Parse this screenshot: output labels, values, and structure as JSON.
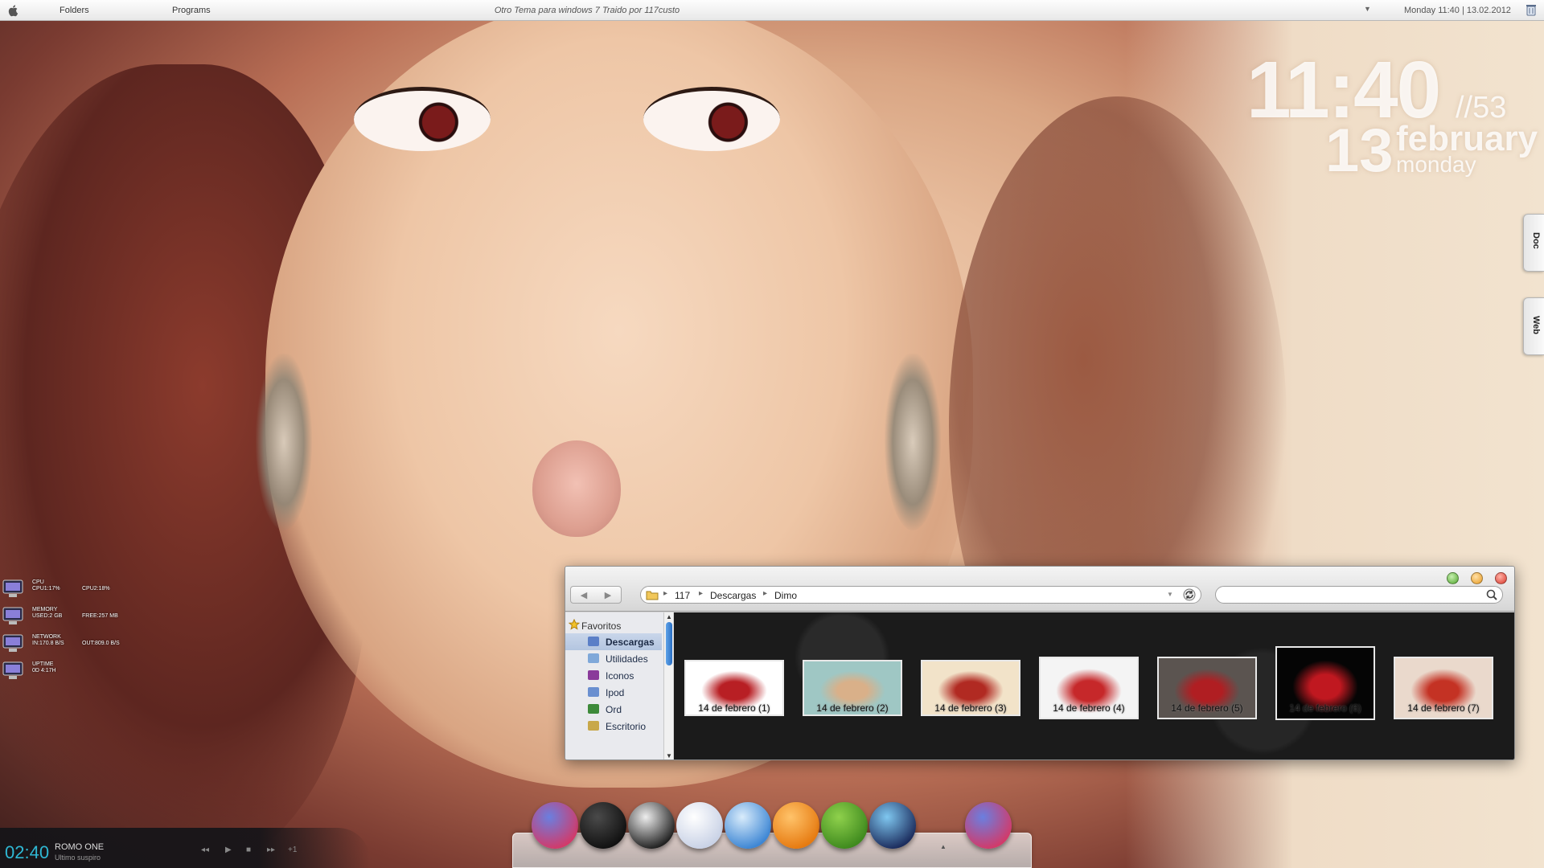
{
  "menubar": {
    "folders_label": "Folders",
    "programs_label": "Programs",
    "title": "Otro Tema para windows 7 Traido por 117custo",
    "clock": "Monday 11:40 | 13.02.2012"
  },
  "big_clock": {
    "hour_minute": "11:40",
    "seconds": "//53",
    "day": "13",
    "month": "february",
    "weekday": "monday"
  },
  "side_tabs": [
    "Doc",
    "Web"
  ],
  "sysmon": {
    "cpu": {
      "label": "CPU",
      "v1": "CPU1:17%",
      "v2": "CPU2:18%"
    },
    "memory": {
      "label": "MEMORY",
      "v1": "USED:2 GB",
      "v2": "FREE:257 MB"
    },
    "network": {
      "label": "NETWORK",
      "v1": "IN:170.8 B/S",
      "v2": "OUT:809.0 B/S"
    },
    "uptime": {
      "label": "UPTIME",
      "v1": "0D 4:17H",
      "v2": ""
    }
  },
  "explorer": {
    "breadcrumbs": [
      "117",
      "Descargas",
      "Dimo"
    ],
    "search_placeholder": "",
    "favorites_label": "Favoritos",
    "sidebar_items": [
      {
        "label": "Descargas",
        "icon": "downloads-folder-icon",
        "color": "#5b7fc7",
        "selected": true
      },
      {
        "label": "Utilidades",
        "icon": "utilities-folder-icon",
        "color": "#7fa8d9",
        "selected": false
      },
      {
        "label": "Iconos",
        "icon": "icons-folder-icon",
        "color": "#8a3a9a",
        "selected": false
      },
      {
        "label": "Ipod",
        "icon": "ipod-folder-icon",
        "color": "#6a8fd0",
        "selected": false
      },
      {
        "label": "Ord",
        "icon": "ord-folder-icon",
        "color": "#3d8a3a",
        "selected": false
      },
      {
        "label": "Escritorio",
        "icon": "desktop-folder-icon",
        "color": "#c8a84a",
        "selected": false
      }
    ],
    "files": [
      {
        "caption": "14 de febrero (1)",
        "colors": [
          "#ffffff",
          "#b81f24"
        ]
      },
      {
        "caption": "14 de febrero (2)",
        "colors": [
          "#9fc7c4",
          "#d9b089"
        ]
      },
      {
        "caption": "14 de febrero (3)",
        "colors": [
          "#f2e3c9",
          "#b12a22"
        ]
      },
      {
        "caption": "14 de febrero (4)",
        "colors": [
          "#f4f4f4",
          "#c6282a"
        ]
      },
      {
        "caption": "14 de febrero (5)",
        "colors": [
          "#5b5450",
          "#b01e22"
        ]
      },
      {
        "caption": "14 de febrero (6)",
        "colors": [
          "#050505",
          "#c01820"
        ]
      },
      {
        "caption": "14 de febrero (7)",
        "colors": [
          "#ead9cc",
          "#c43224"
        ]
      }
    ]
  },
  "dock": {
    "icons": [
      {
        "name": "bird-app-icon",
        "colors": [
          "#6a7fe0",
          "#d23a6a"
        ]
      },
      {
        "name": "camera-lens-icon",
        "colors": [
          "#4a4a4a",
          "#111111"
        ]
      },
      {
        "name": "penguin-app-icon",
        "colors": [
          "#eeeeee",
          "#222222"
        ]
      },
      {
        "name": "ghost-app-icon",
        "colors": [
          "#ffffff",
          "#c9d2e6"
        ]
      },
      {
        "name": "browser-globe-icon",
        "colors": [
          "#d9ecfb",
          "#3d86d4"
        ]
      },
      {
        "name": "music-player-icon",
        "colors": [
          "#ffc36a",
          "#e67a10"
        ]
      },
      {
        "name": "dinosaur-app-icon",
        "colors": [
          "#8fd14c",
          "#3f8a1e"
        ]
      },
      {
        "name": "media-disc-icon",
        "colors": [
          "#7fc7f0",
          "#1c2d5e"
        ]
      },
      {
        "name": "bird-app-icon-2",
        "colors": [
          "#6a7fe0",
          "#d23a6a"
        ]
      }
    ]
  },
  "player": {
    "time": "02:40",
    "artist": "ROMO ONE",
    "song": "Ultimo suspiro",
    "prev": "◂◂",
    "play": "▶",
    "stop": "■",
    "next": "▸▸",
    "extra": "+1"
  }
}
